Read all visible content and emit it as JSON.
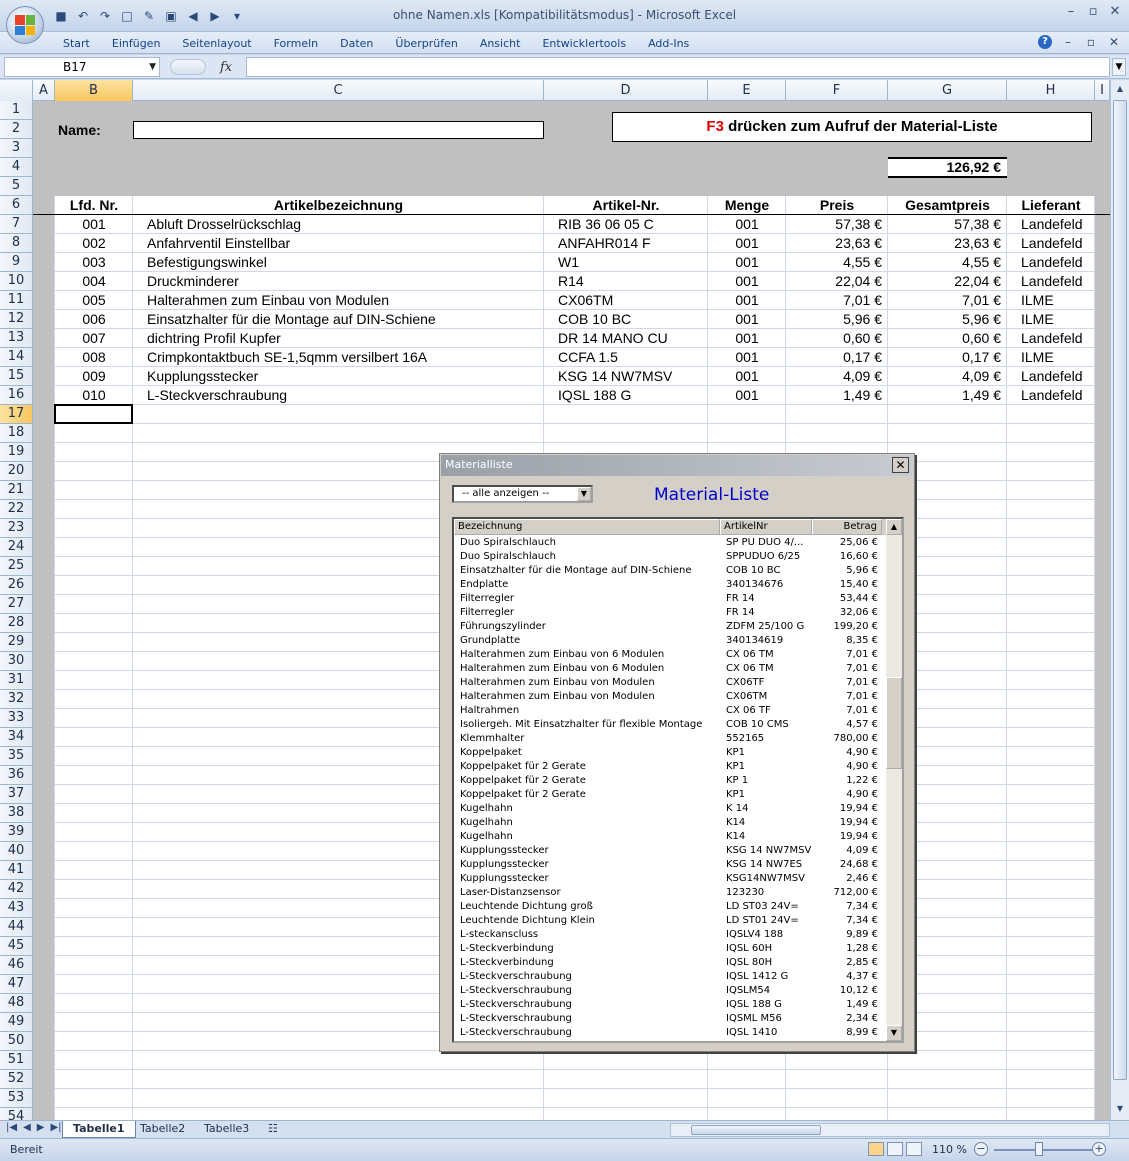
{
  "window": {
    "title": "ohne Namen.xls  [Kompatibilitätsmodus] - Microsoft Excel",
    "minimize": "–",
    "restore": "▫",
    "close": "✕"
  },
  "ribbon": {
    "tabs": [
      "Start",
      "Einfügen",
      "Seitenlayout",
      "Formeln",
      "Daten",
      "Überprüfen",
      "Ansicht",
      "Entwicklertools",
      "Add-Ins"
    ]
  },
  "formula_bar": {
    "name_box": "B17",
    "fx_label": "fx",
    "value": ""
  },
  "columns": [
    "A",
    "B",
    "C",
    "D",
    "E",
    "F",
    "G",
    "H",
    "I"
  ],
  "rows": [
    "1",
    "2",
    "3",
    "4",
    "5",
    "6",
    "7",
    "8",
    "9",
    "10",
    "11",
    "12",
    "13",
    "14",
    "15",
    "16",
    "17",
    "18",
    "19",
    "20",
    "21",
    "22",
    "23",
    "24",
    "25",
    "26",
    "27",
    "28",
    "29",
    "30",
    "31",
    "32",
    "33",
    "34",
    "35",
    "36",
    "37",
    "38",
    "39",
    "40",
    "41",
    "42",
    "43",
    "44",
    "45",
    "46",
    "47",
    "48",
    "49",
    "50",
    "51",
    "52",
    "53",
    "54"
  ],
  "sheet": {
    "name_label": "Name:",
    "name_value": "",
    "f3_key": "F3",
    "f3_text": " drücken zum Aufruf der  Material-Liste",
    "total": "126,92 €",
    "headers": [
      "Lfd. Nr.",
      "Artikelbezeichnung",
      "Artikel-Nr.",
      "Menge",
      "Preis",
      "Gesamtpreis",
      "Lieferant"
    ],
    "items": [
      {
        "nr": "001",
        "bez": "Abluft Drosselrückschlag",
        "art": "RIB 36 06 05 C",
        "menge": "001",
        "preis": "57,38 €",
        "gesamt": "57,38 €",
        "lief": "Landefeld"
      },
      {
        "nr": "002",
        "bez": "Anfahrventil Einstellbar",
        "art": "ANFAHR014 F",
        "menge": "001",
        "preis": "23,63 €",
        "gesamt": "23,63 €",
        "lief": "Landefeld"
      },
      {
        "nr": "003",
        "bez": "Befestigungswinkel",
        "art": "W1",
        "menge": "001",
        "preis": "4,55 €",
        "gesamt": "4,55 €",
        "lief": "Landefeld"
      },
      {
        "nr": "004",
        "bez": "Druckminderer",
        "art": "R14",
        "menge": "001",
        "preis": "22,04 €",
        "gesamt": "22,04 €",
        "lief": "Landefeld"
      },
      {
        "nr": "005",
        "bez": "Halterahmen zum Einbau von Modulen",
        "art": "CX06TM",
        "menge": "001",
        "preis": "7,01 €",
        "gesamt": "7,01 €",
        "lief": "ILME"
      },
      {
        "nr": "006",
        "bez": "Einsatzhalter für die Montage auf DIN-Schiene",
        "art": "COB 10 BC",
        "menge": "001",
        "preis": "5,96 €",
        "gesamt": "5,96 €",
        "lief": "ILME"
      },
      {
        "nr": "007",
        "bez": "dichtring Profil Kupfer",
        "art": "DR 14 MANO CU",
        "menge": "001",
        "preis": "0,60 €",
        "gesamt": "0,60 €",
        "lief": "Landefeld"
      },
      {
        "nr": "008",
        "bez": "Crimpkontaktbuch SE-1,5qmm versilbert 16A",
        "art": "CCFA 1.5",
        "menge": "001",
        "preis": "0,17 €",
        "gesamt": "0,17 €",
        "lief": "ILME"
      },
      {
        "nr": "009",
        "bez": "Kupplungsstecker",
        "art": "KSG 14 NW7MSV",
        "menge": "001",
        "preis": "4,09 €",
        "gesamt": "4,09 €",
        "lief": "Landefeld"
      },
      {
        "nr": "010",
        "bez": "L-Steckverschraubung",
        "art": "IQSL 188 G",
        "menge": "001",
        "preis": "1,49 €",
        "gesamt": "1,49 €",
        "lief": "Landefeld"
      }
    ]
  },
  "sheet_tabs": [
    "Tabelle1",
    "Tabelle2",
    "Tabelle3"
  ],
  "status": {
    "ready": "Bereit",
    "zoom": "110 %"
  },
  "dialog": {
    "title": "Materialliste",
    "close": "✕",
    "filter_value": "-- alle anzeigen --",
    "heading": "Material-Liste",
    "columns": [
      "Bezeichnung",
      "ArtikelNr",
      "Betrag"
    ],
    "rows": [
      [
        "Duo Spiralschlauch",
        "SP PU DUO 4/...",
        "25,06 €"
      ],
      [
        "Duo Spiralschlauch",
        "SPPUDUO 6/25",
        "16,60 €"
      ],
      [
        "Einsatzhalter für die Montage auf DIN-Schiene",
        "COB 10 BC",
        "5,96 €"
      ],
      [
        "Endplatte",
        "340134676",
        "15,40 €"
      ],
      [
        "Filterregler",
        "FR 14",
        "53,44 €"
      ],
      [
        "Filterregler",
        "FR 14",
        "32,06 €"
      ],
      [
        "Führungszylinder",
        "ZDFM 25/100 G",
        "199,20 €"
      ],
      [
        "Grundplatte",
        "340134619",
        "8,35 €"
      ],
      [
        "Halterahmen zum Einbau von 6 Modulen",
        "CX 06 TM",
        "7,01 €"
      ],
      [
        "Halterahmen zum Einbau von 6 Modulen",
        "CX 06 TM",
        "7,01 €"
      ],
      [
        "Halterahmen zum Einbau von Modulen",
        "CX06TF",
        "7,01 €"
      ],
      [
        "Halterahmen zum Einbau von Modulen",
        "CX06TM",
        "7,01 €"
      ],
      [
        "Haltrahmen",
        "CX 06 TF",
        "7,01 €"
      ],
      [
        "Isoliergeh. Mit Einsatzhalter für flexible Montage",
        "COB 10 CMS",
        "4,57 €"
      ],
      [
        "Klemmhalter",
        "552165",
        "780,00 €"
      ],
      [
        "Koppelpaket",
        "KP1",
        "4,90 €"
      ],
      [
        "Koppelpaket für 2 Gerate",
        "KP1",
        "4,90 €"
      ],
      [
        "Koppelpaket für 2 Gerate",
        "KP 1",
        "1,22 €"
      ],
      [
        "Koppelpaket für 2 Gerate",
        "KP1",
        "4,90 €"
      ],
      [
        "Kugelhahn",
        "K 14",
        "19,94 €"
      ],
      [
        "Kugelhahn",
        "K14",
        "19,94 €"
      ],
      [
        "Kugelhahn",
        "K14",
        "19,94 €"
      ],
      [
        "Kupplungsstecker",
        "KSG 14 NW7MSV",
        "4,09 €"
      ],
      [
        "Kupplungsstecker",
        "KSG 14 NW7ES",
        "24,68 €"
      ],
      [
        "Kupplungsstecker",
        "KSG14NW7MSV",
        "2,46 €"
      ],
      [
        "Laser-Distanzsensor",
        "123230",
        "712,00 €"
      ],
      [
        "Leuchtende Dichtung groß",
        "LD ST03 24V=",
        "7,34 €"
      ],
      [
        "Leuchtende Dichtung Klein",
        "LD ST01 24V=",
        "7,34 €"
      ],
      [
        "L-steckanscluss",
        "IQSLV4 188",
        "9,89 €"
      ],
      [
        "L-Steckverbindung",
        "IQSL 60H",
        "1,28 €"
      ],
      [
        "L-Steckverbindung",
        "IQSL 80H",
        "2,85 €"
      ],
      [
        "L-Steckverschraubung",
        "IQSL 1412 G",
        "4,37 €"
      ],
      [
        "L-Steckverschraubung",
        "IQSLM54",
        "10,12 €"
      ],
      [
        "L-Steckverschraubung",
        "IQSL 188 G",
        "1,49 €"
      ],
      [
        "L-Steckverschraubung",
        "IQSML M56",
        "2,34 €"
      ],
      [
        "L-Steckverschraubung",
        "IQSL 1410",
        "8,99 €"
      ]
    ]
  }
}
